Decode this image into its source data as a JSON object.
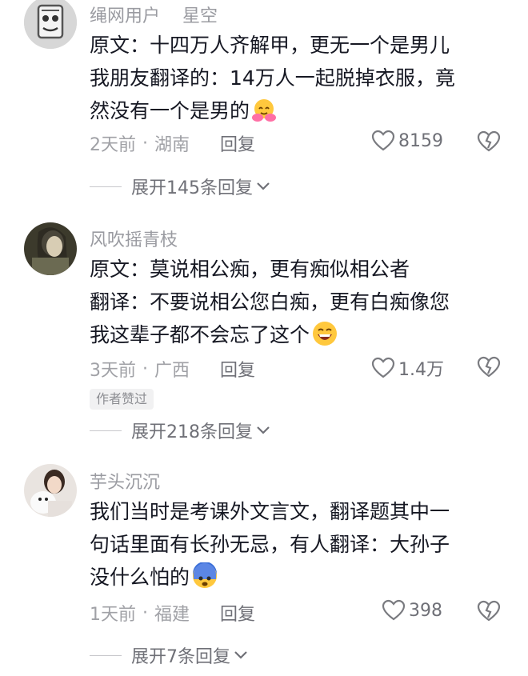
{
  "comments": [
    {
      "username": "绳网用户",
      "tag": "星空",
      "lines": [
        "原文：十四万人齐解甲，更无一个是男儿",
        "我朋友翻译的：14万人一起脱掉衣服，竟",
        "然没有一个是男的"
      ],
      "emoji": "hugging-face-emoji",
      "time": "2天前",
      "location": "湖南",
      "reply_label": "回复",
      "likes": "8159",
      "expand_label": "展开145条回复"
    },
    {
      "username": "风吹摇青枝",
      "lines": [
        "原文：莫说相公痴，更有痴似相公者",
        "翻译：不要说相公您白痴，更有白痴像您",
        "我这辈子都不会忘了这个"
      ],
      "emoji": "grinning-face-emoji",
      "time": "3天前",
      "location": "广西",
      "reply_label": "回复",
      "likes": "1.4万",
      "badge": "作者赞过",
      "expand_label": "展开218条回复"
    },
    {
      "username": "芋头沉沉",
      "lines": [
        "我们当时是考课外文言文，翻译题其中一",
        "句话里面有长孙无忌，有人翻译：大孙子",
        "没什么怕的"
      ],
      "emoji": "fearful-face-emoji",
      "time": "1天前",
      "location": "福建",
      "reply_label": "回复",
      "likes": "398",
      "expand_label": "展开7条回复"
    }
  ],
  "separator": "·",
  "colors": {
    "text": "#161823",
    "secondary": "#9a9ba1",
    "action": "#6f7077"
  }
}
